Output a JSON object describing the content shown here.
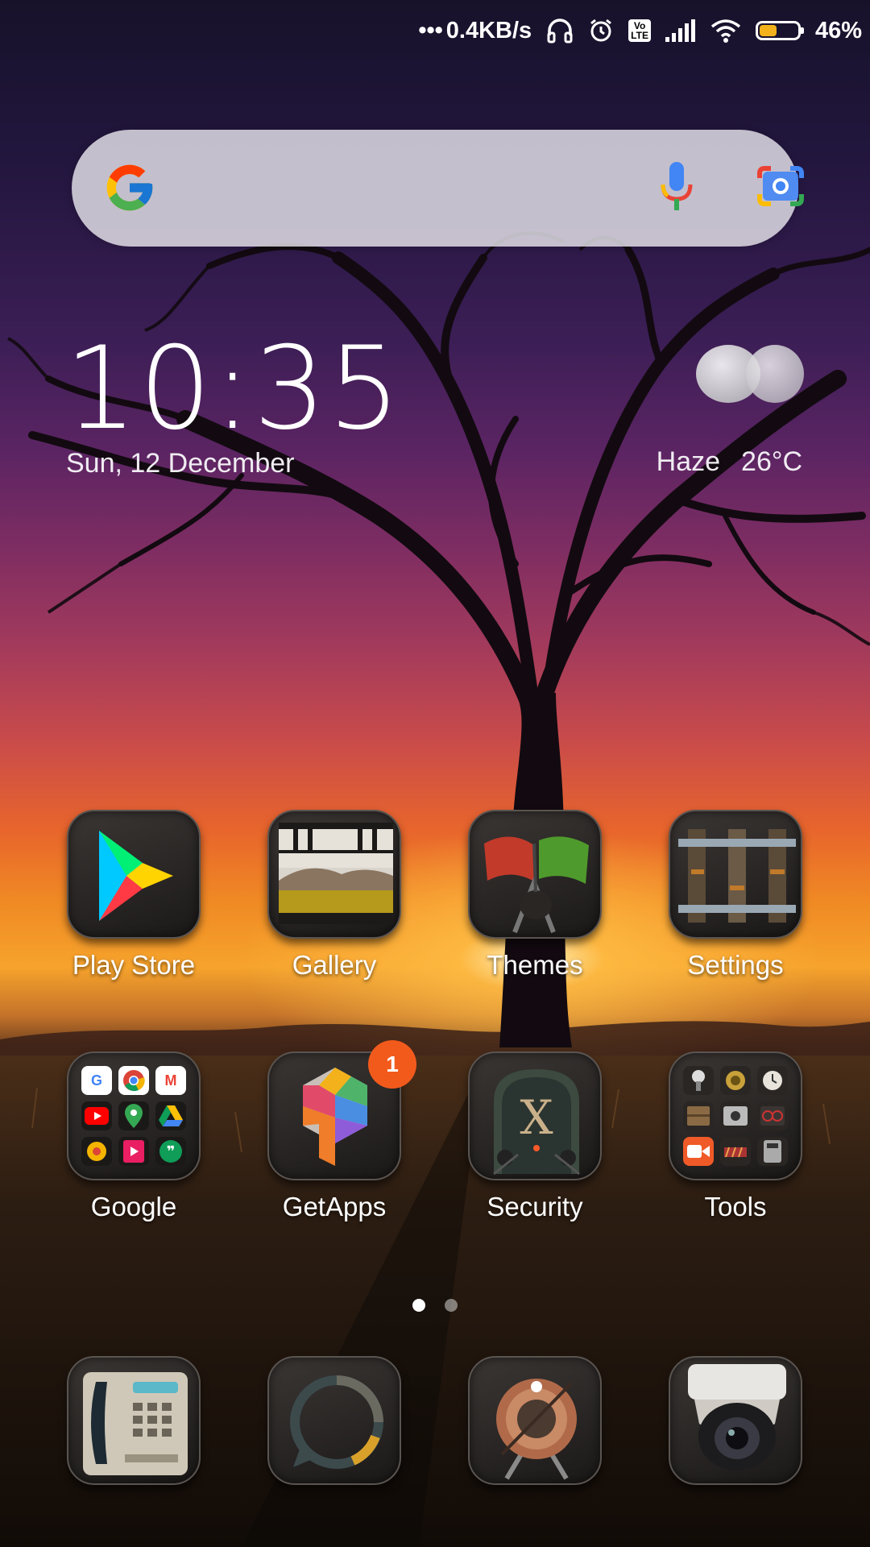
{
  "status_bar": {
    "network_speed": "0.4KB/s",
    "volte_label": "Vo\nLTE",
    "battery_percent": "46%",
    "battery_level": 0.46
  },
  "search": {
    "logo": "google-g-icon",
    "voice_icon": "mic-icon",
    "lens_icon": "camera-lens-icon"
  },
  "clock_widget": {
    "time": "10:35",
    "date": "Sun, 12 December",
    "weather_condition": "Haze",
    "temperature": "26°C",
    "weather_icon": "haze-cloud-icon"
  },
  "apps_row1": [
    {
      "label": "Play Store"
    },
    {
      "label": "Gallery"
    },
    {
      "label": "Themes"
    },
    {
      "label": "Settings"
    }
  ],
  "apps_row2": [
    {
      "label": "Google"
    },
    {
      "label": "GetApps",
      "badge": "1"
    },
    {
      "label": "Security"
    },
    {
      "label": "Tools"
    }
  ],
  "security_icon_letter": "X",
  "google_folder_letters": [
    "G",
    "",
    "M",
    "",
    "",
    "",
    "",
    "",
    "❞"
  ],
  "page_indicator": {
    "pages": 2,
    "current": 1
  },
  "dock": [
    {
      "icon": "phone-icon"
    },
    {
      "icon": "messages-icon"
    },
    {
      "icon": "browser-icon"
    },
    {
      "icon": "camera-icon"
    }
  ],
  "colors": {
    "badge": "#f25a1c",
    "battery_fill": "#f3b21b",
    "search_bar": "#e6e4eb"
  }
}
